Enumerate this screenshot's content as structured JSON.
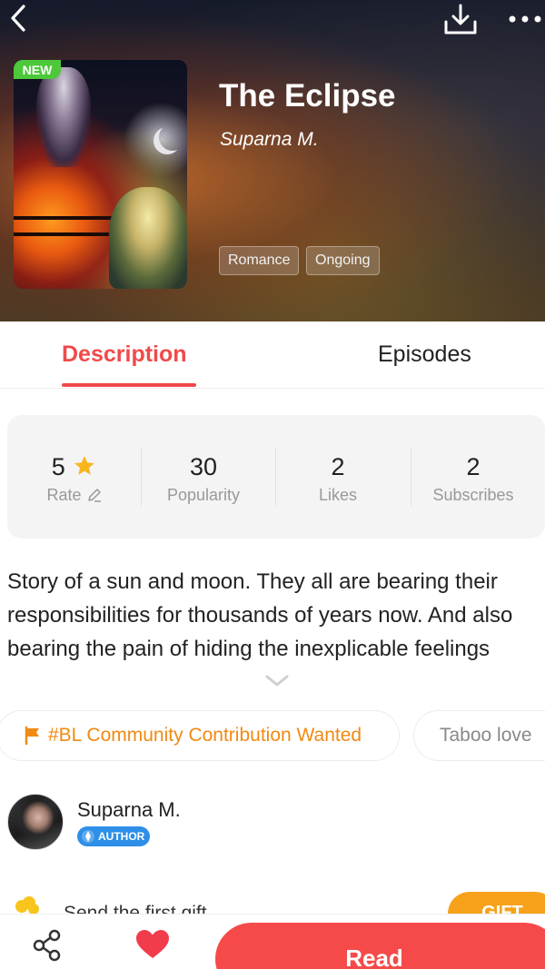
{
  "header": {
    "title": "The Eclipse",
    "author": "Suparna M.",
    "new_badge": "NEW",
    "tags": [
      "Romance",
      "Ongoing"
    ],
    "icons": [
      "back-icon",
      "download-icon",
      "more-icon"
    ]
  },
  "tabs": [
    {
      "label": "Description",
      "active": true
    },
    {
      "label": "Episodes",
      "active": false
    }
  ],
  "stats": [
    {
      "value": "5",
      "label": "Rate"
    },
    {
      "value": "30",
      "label": "Popularity"
    },
    {
      "value": "2",
      "label": "Likes"
    },
    {
      "value": "2",
      "label": "Subscribes"
    }
  ],
  "description": "Story of a sun and moon. They all are bearing their responsibilities for thousands of years now. And also bearing the pain of hiding the inexplicable feelings",
  "chips": [
    {
      "label": "#BL Community Contribution Wanted",
      "icon": "flag-icon"
    },
    {
      "label": "Taboo love"
    }
  ],
  "author_card": {
    "name": "Suparna M.",
    "badge": "AUTHOR"
  },
  "gift": {
    "text": "Send the first gift",
    "button": "GIFT"
  },
  "bottom_bar": {
    "read_label": "Read",
    "icons": [
      "share-icon",
      "heart-icon"
    ]
  },
  "colors": {
    "accent": "#f04a4a",
    "read_button": "#f64a4a",
    "new_badge": "#4cc83a",
    "chip_orange": "#f08a12",
    "author_badge": "#2d8fe8",
    "star": "#f8b51e"
  }
}
